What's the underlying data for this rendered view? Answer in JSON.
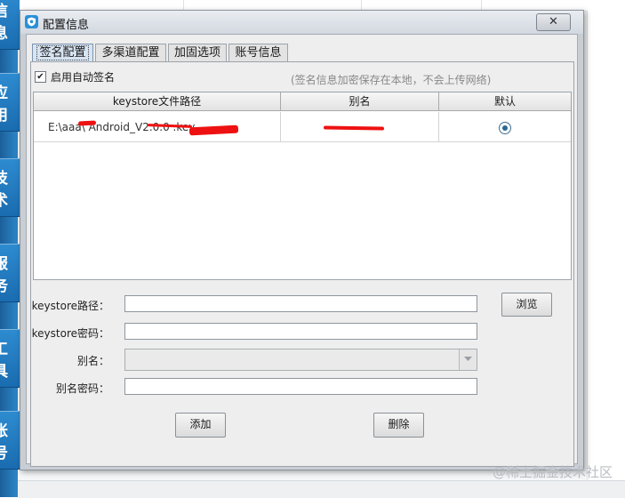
{
  "background": {
    "side_items": [
      "信息",
      "应用",
      "技术",
      "服务",
      "工具",
      "账号"
    ]
  },
  "dialog": {
    "title": "配置信息",
    "close_label": "✕",
    "tabs": [
      "签名配置",
      "多渠道配置",
      "加固选项",
      "账号信息"
    ],
    "active_tab": 0,
    "auto_sign_label": "启用自动签名",
    "auto_sign_checked": true,
    "hint": "(签名信息加密保存在本地，不会上传网络)",
    "table": {
      "headers": [
        "keystore文件路径",
        "别名",
        "默认"
      ],
      "rows": [
        {
          "path": "E:\\aaa\\  Android_V2.0.0  .key",
          "alias": "",
          "default": true
        }
      ]
    },
    "form": {
      "keystore_path_label": "keystore路径：",
      "keystore_password_label": "keystore密码：",
      "alias_label": "别名：",
      "alias_password_label": "别名密码：",
      "keystore_path_value": "",
      "keystore_password_value": "",
      "alias_value": "",
      "alias_password_value": "",
      "browse_label": "浏览",
      "add_label": "添加",
      "delete_label": "删除"
    }
  },
  "watermark": "@稀土掘金技术社区",
  "colors": {
    "accent": "#2b8fd6",
    "redaction": "#e11111"
  }
}
